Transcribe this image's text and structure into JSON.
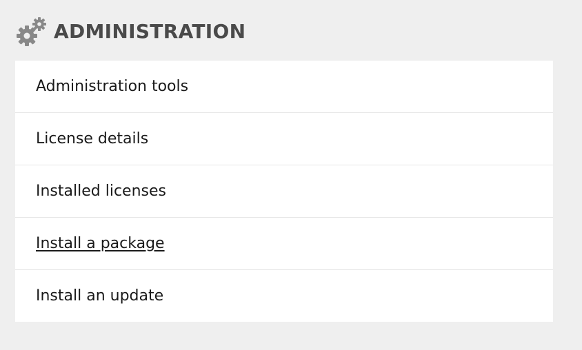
{
  "header": {
    "icon": "gears-icon",
    "title": "ADMINISTRATION"
  },
  "menu": {
    "items": [
      {
        "label": "Administration tools"
      },
      {
        "label": "License details"
      },
      {
        "label": "Installed licenses"
      },
      {
        "label": "Install a package",
        "state": "hovered-underlined"
      },
      {
        "label": "Install an update"
      }
    ]
  },
  "colors": {
    "page_background": "#efefef",
    "panel_background": "#ffffff",
    "title_text": "#4a4a4a",
    "item_text": "#1a1a1a",
    "divider": "#e6e6e6",
    "icon": "#888888"
  }
}
